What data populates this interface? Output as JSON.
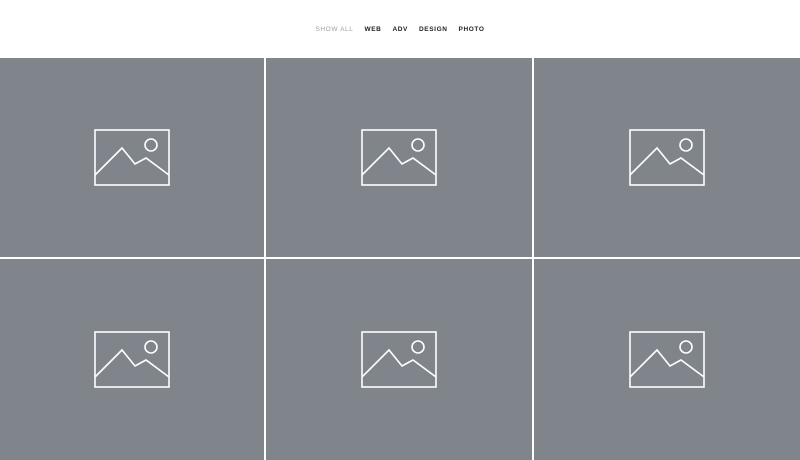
{
  "filters": {
    "items": [
      {
        "label": "SHOW ALL",
        "active": true
      },
      {
        "label": "WEB",
        "active": false
      },
      {
        "label": "ADV",
        "active": false
      },
      {
        "label": "DESIGN",
        "active": false
      },
      {
        "label": "PHOTO",
        "active": false
      }
    ]
  },
  "gallery": {
    "tiles": [
      {
        "icon": "image-placeholder-icon"
      },
      {
        "icon": "image-placeholder-icon"
      },
      {
        "icon": "image-placeholder-icon"
      },
      {
        "icon": "image-placeholder-icon"
      },
      {
        "icon": "image-placeholder-icon"
      },
      {
        "icon": "image-placeholder-icon"
      }
    ]
  },
  "colors": {
    "tile_background": "#80858c",
    "active_filter": "#9a9ea3",
    "filter_text": "#222222",
    "icon_stroke": "#ffffff"
  }
}
